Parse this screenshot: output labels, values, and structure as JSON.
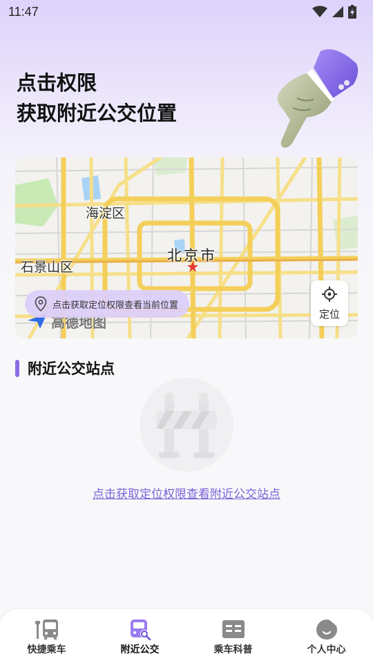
{
  "status_bar": {
    "time": "11:47"
  },
  "hero": {
    "line1": "点击权限",
    "line2": "获取附近公交位置"
  },
  "map": {
    "labels": {
      "haidian": "海淀区",
      "shijingshan": "石景山区",
      "beijing": "北京市"
    },
    "prompt_text": "点击获取定位权限查看当前位置",
    "locate_label": "定位",
    "logo_text": "高德地图"
  },
  "section": {
    "title": "附近公交站点"
  },
  "empty_state": {
    "link_text": "点击获取定位权限查看附近公交站点"
  },
  "tabs": [
    {
      "label": "快捷乘车",
      "icon": "bus-stop-icon",
      "active": false
    },
    {
      "label": "附近公交",
      "icon": "bus-search-icon",
      "active": true
    },
    {
      "label": "乘车科普",
      "icon": "book-icon",
      "active": false
    },
    {
      "label": "个人中心",
      "icon": "profile-icon",
      "active": false
    }
  ],
  "colors": {
    "accent": "#8b6ce8",
    "link": "#7a62d6",
    "active_tab": "#9a7cf0",
    "inactive_tab": "#8a8a8a"
  }
}
